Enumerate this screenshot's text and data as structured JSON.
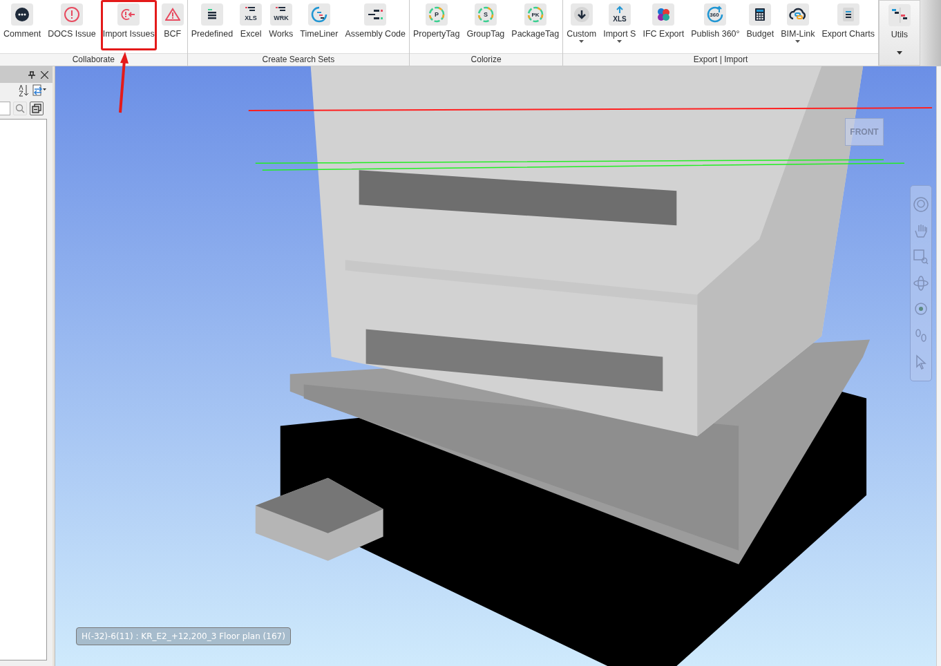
{
  "ribbon": {
    "groups": [
      {
        "label": "Collaborate",
        "buttons": [
          {
            "label": "Comment",
            "kind": "comment",
            "highlighted": false,
            "dropdown": false
          },
          {
            "label": "DOCS Issue",
            "kind": "alert",
            "highlighted": false,
            "dropdown": false
          },
          {
            "label": "Import Issues",
            "kind": "import",
            "highlighted": true,
            "dropdown": false
          },
          {
            "label": "BCF",
            "kind": "warning",
            "highlighted": false,
            "dropdown": false
          }
        ]
      },
      {
        "label": "Create Search Sets",
        "buttons": [
          {
            "label": "Predefined",
            "kind": "list",
            "highlighted": false,
            "dropdown": false
          },
          {
            "label": "Excel",
            "kind": "badge",
            "icon_text": "XLS",
            "highlighted": false,
            "dropdown": false
          },
          {
            "label": "Works",
            "kind": "badge",
            "icon_text": "WRK",
            "highlighted": false,
            "dropdown": false
          },
          {
            "label": "TimeLiner",
            "kind": "timeline",
            "highlighted": false,
            "dropdown": false
          },
          {
            "label": "Assembly Code",
            "kind": "tree",
            "highlighted": false,
            "dropdown": false
          }
        ]
      },
      {
        "label": "Colorize",
        "buttons": [
          {
            "label": "PropertyTag",
            "kind": "tag",
            "icon_text": "P",
            "highlighted": false,
            "dropdown": false
          },
          {
            "label": "GroupTag",
            "kind": "tag",
            "icon_text": "S",
            "highlighted": false,
            "dropdown": false
          },
          {
            "label": "PackageTag",
            "kind": "tag",
            "icon_text": "PK",
            "highlighted": false,
            "dropdown": false
          }
        ]
      },
      {
        "label": "Export | Import",
        "buttons": [
          {
            "label": "Custom",
            "kind": "download",
            "highlighted": false,
            "dropdown": true
          },
          {
            "label": "Import S",
            "kind": "upload",
            "icon_text": "XLS",
            "highlighted": false,
            "dropdown": true
          },
          {
            "label": "IFC Export",
            "kind": "ifc",
            "highlighted": false,
            "dropdown": false
          },
          {
            "label": "Publish 360°",
            "kind": "publish",
            "icon_text": "360",
            "highlighted": false,
            "dropdown": false
          },
          {
            "label": "Budget",
            "kind": "calculator",
            "highlighted": false,
            "dropdown": false
          },
          {
            "label": "BIM-Link",
            "kind": "cloud",
            "highlighted": false,
            "dropdown": true
          },
          {
            "label": "Export Charts",
            "kind": "chart",
            "highlighted": false,
            "dropdown": false
          }
        ]
      }
    ],
    "utils": {
      "label": "Utils"
    }
  },
  "viewport": {
    "view_cube": "FRONT",
    "status": "H(-32)-6(11) : KR_E2_+12,200_3 Floor plan (167)"
  }
}
